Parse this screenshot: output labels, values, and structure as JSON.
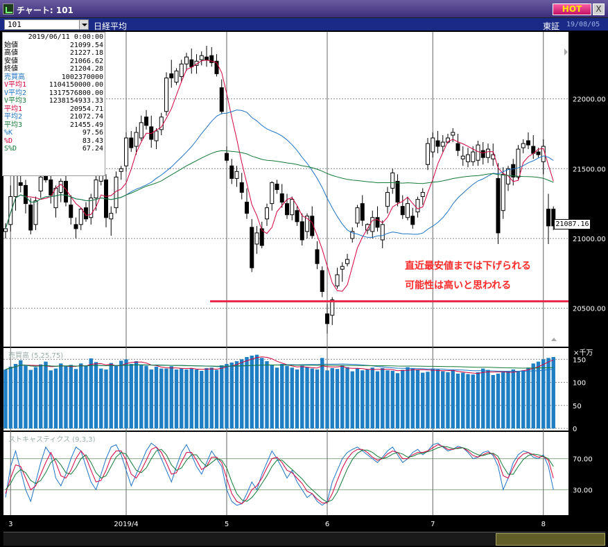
{
  "window": {
    "title": "チャート: 101",
    "hot_label": "HOT",
    "close_label": "X"
  },
  "header": {
    "symbol": "101",
    "instrument": "日経平均",
    "exchange": "東証",
    "date": "19/08/05"
  },
  "info_panel": {
    "date": "2019/06/11 0:00:00",
    "rows": [
      {
        "label": "始値",
        "value": "21099.54",
        "color": "#000"
      },
      {
        "label": "高値",
        "value": "21227.18",
        "color": "#000"
      },
      {
        "label": "安値",
        "value": "21066.62",
        "color": "#000"
      },
      {
        "label": "終値",
        "value": "21204.28",
        "color": "#000"
      },
      {
        "label": "売買高",
        "value": "1002370000",
        "color": "#1d73c6"
      },
      {
        "label": "V平均1",
        "value": "1104150000.00",
        "color": "#d4003c"
      },
      {
        "label": "V平均2",
        "value": "1317576800.00",
        "color": "#1d73c6"
      },
      {
        "label": "V平均3",
        "value": "1238154933.33",
        "color": "#137a37"
      },
      {
        "label": "平均1",
        "value": "20954.71",
        "color": "#d4003c"
      },
      {
        "label": "平均2",
        "value": "21072.74",
        "color": "#1d73c6"
      },
      {
        "label": "平均3",
        "value": "21455.49",
        "color": "#137a37"
      },
      {
        "label": "%K",
        "value": "97.56",
        "color": "#1d73c6"
      },
      {
        "label": "%D",
        "value": "83.43",
        "color": "#d4003c"
      },
      {
        "label": "S%D",
        "value": "67.24",
        "color": "#137a37"
      }
    ]
  },
  "annotations": {
    "line1": "直近最安値までは下げられる",
    "line2": "可能性は高いと思われる",
    "support_price": 20550
  },
  "price_tag": "21087.16",
  "panels": {
    "volume_label": "売買高 (5,25,75)",
    "volume_unit": "×千万",
    "stoch_label": "ストキャスティクス (9,3,3)"
  },
  "colors": {
    "up": "#ffffff",
    "down": "#000000",
    "ma1": "#d4003c",
    "ma2": "#1d73c6",
    "ma3": "#137a37",
    "volume_bar": "#1f7fc4",
    "support": "#e8254a"
  },
  "chart_data": {
    "type": "candlestick",
    "price_axis": {
      "ylim": [
        20250,
        22450
      ],
      "ticks": [
        22000,
        21500,
        21000,
        20500
      ],
      "tick_labels": [
        "22000.00",
        "21500.00",
        "21000.00",
        "20500.00"
      ]
    },
    "volume_axis": {
      "ylim": [
        0,
        170
      ],
      "ticks": [
        150,
        100,
        50,
        0
      ],
      "tick_labels": [
        "150",
        "100",
        "50",
        "0"
      ]
    },
    "stoch_axis": {
      "ylim": [
        0,
        100
      ],
      "ticks": [
        70,
        30
      ],
      "tick_labels": [
        "70.00",
        "30.00"
      ]
    },
    "x_labels": [
      {
        "index": 1,
        "label": "3"
      },
      {
        "index": 24,
        "label": "2019/4"
      },
      {
        "index": 44,
        "label": "5"
      },
      {
        "index": 64,
        "label": "6"
      },
      {
        "index": 85,
        "label": "7"
      },
      {
        "index": 107,
        "label": "8"
      }
    ],
    "x_count": 110,
    "candles": [
      [
        21050,
        21110,
        21000,
        21070
      ],
      [
        21100,
        21380,
        21050,
        21300
      ],
      [
        21300,
        21540,
        21200,
        21500
      ],
      [
        21400,
        21480,
        21330,
        21380
      ],
      [
        21380,
        21420,
        21180,
        21250
      ],
      [
        21240,
        21290,
        21030,
        21060
      ],
      [
        21100,
        21300,
        21060,
        21270
      ],
      [
        21340,
        21480,
        21290,
        21440
      ],
      [
        21480,
        21560,
        21400,
        21420
      ],
      [
        21420,
        21450,
        21250,
        21310
      ],
      [
        21220,
        21380,
        21150,
        21360
      ],
      [
        21330,
        21430,
        21260,
        21410
      ],
      [
        21410,
        21450,
        21230,
        21260
      ],
      [
        21240,
        21310,
        21100,
        21150
      ],
      [
        21100,
        21150,
        21000,
        21070
      ],
      [
        21100,
        21220,
        21060,
        21210
      ],
      [
        21220,
        21260,
        21120,
        21140
      ],
      [
        21150,
        21320,
        21100,
        21290
      ],
      [
        21290,
        21480,
        21200,
        21420
      ],
      [
        21410,
        21520,
        21380,
        21500
      ],
      [
        21420,
        21460,
        21080,
        21150
      ],
      [
        21140,
        21230,
        21020,
        21180
      ],
      [
        21220,
        21480,
        21180,
        21440
      ],
      [
        21480,
        21520,
        21420,
        21500
      ],
      [
        21520,
        21760,
        21480,
        21720
      ],
      [
        21720,
        21770,
        21620,
        21650
      ],
      [
        21660,
        21800,
        21600,
        21760
      ],
      [
        21720,
        21880,
        21700,
        21830
      ],
      [
        21870,
        21920,
        21780,
        21810
      ],
      [
        21800,
        21880,
        21650,
        21710
      ],
      [
        21700,
        21790,
        21640,
        21770
      ],
      [
        21780,
        21900,
        21740,
        21870
      ],
      [
        21910,
        22190,
        21880,
        22150
      ],
      [
        22180,
        22280,
        22080,
        22150
      ],
      [
        22120,
        22220,
        22100,
        22200
      ],
      [
        22160,
        22280,
        22120,
        22250
      ],
      [
        22250,
        22330,
        22200,
        22300
      ],
      [
        22280,
        22360,
        22180,
        22230
      ],
      [
        22240,
        22320,
        22180,
        22270
      ],
      [
        22280,
        22340,
        22240,
        22310
      ],
      [
        22300,
        22380,
        22230,
        22280
      ],
      [
        22310,
        22370,
        22230,
        22260
      ],
      [
        22270,
        22320,
        22160,
        22180
      ],
      [
        22080,
        22140,
        21890,
        21910
      ],
      [
        21610,
        21660,
        21540,
        21560
      ],
      [
        21520,
        21570,
        21390,
        21430
      ],
      [
        21430,
        21520,
        21370,
        21480
      ],
      [
        21400,
        21470,
        21280,
        21330
      ],
      [
        21260,
        21360,
        21140,
        21180
      ],
      [
        21080,
        21140,
        20760,
        20790
      ],
      [
        20960,
        21090,
        20890,
        21040
      ],
      [
        21070,
        21120,
        20930,
        20950
      ],
      [
        21140,
        21250,
        21090,
        21220
      ],
      [
        21250,
        21410,
        21200,
        21400
      ],
      [
        21390,
        21420,
        21320,
        21350
      ],
      [
        21320,
        21390,
        21220,
        21260
      ],
      [
        21250,
        21320,
        21140,
        21170
      ],
      [
        21170,
        21300,
        21130,
        21280
      ],
      [
        21200,
        21230,
        21090,
        21120
      ],
      [
        21120,
        21180,
        20950,
        20990
      ],
      [
        21050,
        21180,
        21000,
        21160
      ],
      [
        21160,
        21230,
        21000,
        21020
      ],
      [
        20920,
        20980,
        20780,
        20820
      ],
      [
        20770,
        20800,
        20580,
        20620
      ],
      [
        20460,
        20530,
        20320,
        20390
      ],
      [
        20450,
        20580,
        20380,
        20560
      ],
      [
        20660,
        20790,
        20640,
        20740
      ],
      [
        20780,
        20830,
        20690,
        20800
      ],
      [
        20820,
        20890,
        20800,
        20850
      ],
      [
        21000,
        21080,
        20970,
        21050
      ],
      [
        21110,
        21240,
        21080,
        21220
      ],
      [
        21250,
        21310,
        21090,
        21130
      ],
      [
        21060,
        21110,
        21030,
        21100
      ],
      [
        21050,
        21200,
        21000,
        21150
      ],
      [
        21150,
        21230,
        21050,
        21080
      ],
      [
        20990,
        21130,
        20930,
        21100
      ],
      [
        21230,
        21370,
        21180,
        21330
      ],
      [
        21360,
        21500,
        21320,
        21470
      ],
      [
        21410,
        21460,
        21230,
        21260
      ],
      [
        21230,
        21310,
        21140,
        21170
      ],
      [
        21150,
        21300,
        21130,
        21250
      ],
      [
        21160,
        21220,
        21070,
        21100
      ],
      [
        21190,
        21300,
        21150,
        21280
      ],
      [
        21300,
        21360,
        21240,
        21330
      ],
      [
        21530,
        21720,
        21490,
        21680
      ],
      [
        21620,
        21760,
        21580,
        21720
      ],
      [
        21700,
        21770,
        21610,
        21660
      ],
      [
        21660,
        21740,
        21620,
        21690
      ],
      [
        21690,
        21750,
        21680,
        21720
      ],
      [
        21740,
        21790,
        21690,
        21760
      ],
      [
        21680,
        21750,
        21590,
        21630
      ],
      [
        21570,
        21660,
        21520,
        21590
      ],
      [
        21550,
        21650,
        21510,
        21600
      ],
      [
        21550,
        21660,
        21520,
        21620
      ],
      [
        21560,
        21700,
        21520,
        21670
      ],
      [
        21630,
        21690,
        21530,
        21580
      ],
      [
        21580,
        21680,
        21540,
        21640
      ],
      [
        21570,
        21680,
        21520,
        21600
      ],
      [
        21430,
        21540,
        20960,
        21040
      ],
      [
        21200,
        21510,
        21140,
        21460
      ],
      [
        21390,
        21520,
        21340,
        21500
      ],
      [
        21530,
        21570,
        21380,
        21440
      ],
      [
        21440,
        21670,
        21420,
        21640
      ],
      [
        21650,
        21710,
        21610,
        21680
      ],
      [
        21700,
        21760,
        21640,
        21670
      ],
      [
        21660,
        21740,
        21570,
        21610
      ],
      [
        21620,
        21650,
        21580,
        21600
      ],
      [
        21550,
        21710,
        21460,
        21660
      ],
      [
        21210,
        21320,
        20960,
        21090
      ],
      [
        21210,
        21230,
        21060,
        21090
      ]
    ],
    "volume": [
      128,
      134,
      140,
      148,
      136,
      127,
      133,
      139,
      145,
      126,
      130,
      141,
      135,
      138,
      129,
      141,
      136,
      152,
      144,
      130,
      128,
      142,
      136,
      147,
      150,
      140,
      146,
      138,
      136,
      128,
      134,
      130,
      130,
      135,
      128,
      130,
      128,
      131,
      128,
      125,
      131,
      132,
      127,
      137,
      140,
      143,
      146,
      150,
      155,
      158,
      160,
      153,
      146,
      138,
      132,
      140,
      136,
      132,
      128,
      136,
      133,
      130,
      128,
      153,
      126,
      131,
      129,
      136,
      133,
      124,
      130,
      126,
      128,
      132,
      124,
      131,
      126,
      125,
      120,
      127,
      133,
      131,
      127,
      121,
      123,
      130,
      128,
      124,
      122,
      126,
      119,
      121,
      118,
      117,
      122,
      130,
      127,
      116,
      119,
      122,
      125,
      128,
      125,
      126,
      132,
      141,
      145,
      150,
      153,
      155
    ],
    "ma": {
      "ma1": "5",
      "ma2": "25",
      "ma3": "75"
    },
    "stoch": {
      "k": [
        20,
        60,
        80,
        55,
        30,
        15,
        40,
        65,
        85,
        75,
        45,
        35,
        50,
        70,
        85,
        80,
        60,
        40,
        30,
        50,
        70,
        85,
        88,
        75,
        55,
        35,
        50,
        65,
        80,
        90,
        85,
        70,
        55,
        40,
        60,
        78,
        88,
        75,
        60,
        50,
        65,
        80,
        70,
        60,
        30,
        15,
        10,
        12,
        25,
        40,
        30,
        50,
        65,
        80,
        70,
        58,
        45,
        55,
        40,
        30,
        20,
        25,
        15,
        10,
        15,
        40,
        55,
        70,
        78,
        82,
        85,
        80,
        75,
        70,
        65,
        72,
        80,
        85,
        75,
        65,
        70,
        78,
        82,
        75,
        80,
        88,
        90,
        85,
        80,
        82,
        86,
        84,
        78,
        70,
        72,
        78,
        80,
        74,
        60,
        30,
        45,
        65,
        75,
        80,
        78,
        72,
        70,
        75,
        60,
        30
      ],
      "d": [
        25,
        45,
        62,
        60,
        45,
        30,
        35,
        50,
        65,
        78,
        65,
        48,
        45,
        55,
        70,
        80,
        72,
        55,
        40,
        42,
        55,
        72,
        80,
        80,
        68,
        50,
        45,
        55,
        68,
        82,
        85,
        78,
        65,
        50,
        52,
        66,
        78,
        78,
        68,
        56,
        60,
        72,
        72,
        65,
        45,
        25,
        15,
        12,
        18,
        30,
        35,
        45,
        58,
        70,
        72,
        65,
        55,
        52,
        45,
        38,
        28,
        25,
        18,
        13,
        13,
        25,
        42,
        58,
        70,
        78,
        82,
        82,
        78,
        72,
        68,
        70,
        76,
        80,
        78,
        70,
        70,
        75,
        78,
        78,
        80,
        84,
        88,
        86,
        82,
        82,
        84,
        84,
        80,
        74,
        72,
        75,
        78,
        76,
        68,
        48,
        45,
        58,
        70,
        76,
        78,
        75,
        72,
        73,
        68,
        45
      ],
      "sd": [
        30,
        38,
        50,
        56,
        52,
        42,
        38,
        42,
        52,
        65,
        70,
        62,
        52,
        50,
        58,
        70,
        75,
        65,
        52,
        45,
        48,
        60,
        72,
        78,
        76,
        65,
        55,
        52,
        58,
        70,
        80,
        82,
        75,
        62,
        55,
        58,
        68,
        75,
        75,
        66,
        60,
        65,
        70,
        68,
        58,
        40,
        25,
        17,
        15,
        20,
        28,
        38,
        48,
        60,
        68,
        68,
        62,
        56,
        50,
        44,
        36,
        30,
        24,
        18,
        14,
        17,
        27,
        42,
        57,
        69,
        77,
        81,
        81,
        78,
        73,
        70,
        72,
        76,
        78,
        76,
        72,
        73,
        76,
        77,
        79,
        81,
        84,
        86,
        85,
        83,
        83,
        84,
        82,
        78,
        75,
        74,
        76,
        77,
        73,
        60,
        50,
        50,
        60,
        69,
        74,
        76,
        75,
        73,
        70,
        60
      ]
    }
  }
}
